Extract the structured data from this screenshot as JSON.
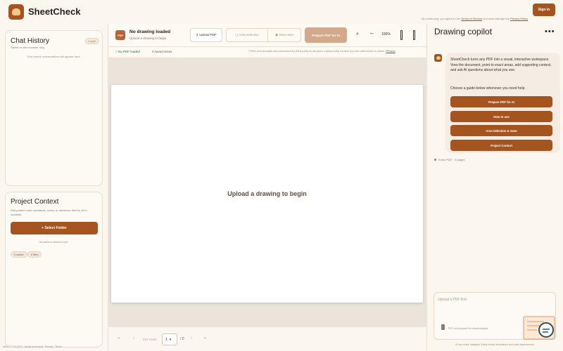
{
  "header": {
    "brand": "SheetCheck",
    "consent_prefix": "By continuing, you agree to the ",
    "terms_link": "Terms of Service",
    "consent_mid": " and acknowledge the ",
    "privacy_link": "Privacy Policy",
    "signin_label": "Sign in"
  },
  "chat_history": {
    "title": "Chat History",
    "subtitle": "Saved on this browser only.",
    "badge": "Local",
    "empty_text": "Your recent conversations will appear here."
  },
  "project_context": {
    "title": "Project Context",
    "description": "Add project rules, standards, notes, or reference files for AI to consider.",
    "select_folder_label": "+ Select Folder",
    "no_folders_text": "No folders selected yet.",
    "chip_active": "0 active",
    "chip_files": "0 files"
  },
  "footer_left": "web/0.77.12 (RO) · [email protected] · Privacy · Terms",
  "toolbar": {
    "pdf_badge": "PDF",
    "doc_title": "No drawing loaded",
    "doc_subtitle": "Upload a drawing to begin",
    "upload_label": "↥ Upload PDF",
    "area_selection_label": "▢ Area selection",
    "save_area_label": "▣ Save area",
    "prepare_label": "Prepare PDF for AI",
    "zoom_in_glyph": "⌕",
    "zoom_out_glyph": "–",
    "zoom_level": "100%"
  },
  "status": {
    "no_pdf": "○ No PDF loaded",
    "saved_areas": "0 saved areas",
    "disclaimer": "PDFs and prompts are processed by third-party AI services. Upload only content you are authorized to share.",
    "privacy_link": "Privacy"
  },
  "viewer": {
    "placeholder": "Upload a drawing to begin"
  },
  "pager": {
    "first": "«",
    "prev": "‹",
    "label": "PDF PAGE",
    "current": "1",
    "total": "/ 0",
    "next": "›",
    "last": "»"
  },
  "copilot": {
    "title": "Drawing copilot",
    "more_glyph": "•••",
    "intro": "SheetCheck turns any PDF into a visual, interactive workspace. View the document, point to exact areas, add supporting context, and ask AI questions about what you see.",
    "choose": "Choose a guide below whenever you need help.",
    "guides": [
      "Prepare PDF for AI",
      "How to use",
      "Area Selection & Save",
      "Project Context"
    ],
    "scope": "Entire PDF · 0 pages",
    "composer_placeholder": "Upload a PDF first",
    "attach_note": "PDF not prepared for visual analysis",
    "ai_note": "AI can make mistakes. Verify critical dimensions and code requirements."
  }
}
